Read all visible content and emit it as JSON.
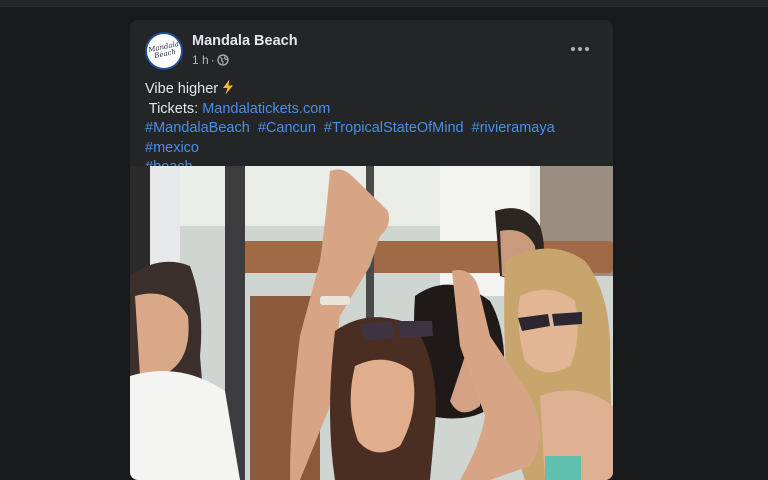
{
  "post": {
    "page_name": "Mandala Beach",
    "avatar_text": "Mandala\nBeach",
    "time": "1 h",
    "privacy_icon": "globe-icon",
    "more_icon": "more-horizontal-icon",
    "text_line1": "Vibe higher",
    "bolt_icon": "lightning-bolt-icon",
    "tickets_label": " Tickets: ",
    "tickets_link": "Mandalatickets.com",
    "hashtags": [
      "#MandalaBeach",
      "#Cancun",
      "#TropicalStateOfMind",
      "#rivieramaya",
      "#mexico",
      "#beach"
    ]
  },
  "colors": {
    "background": "#18191a",
    "card": "#242526",
    "link": "#4a8fe8",
    "bolt": "#f7b928"
  }
}
